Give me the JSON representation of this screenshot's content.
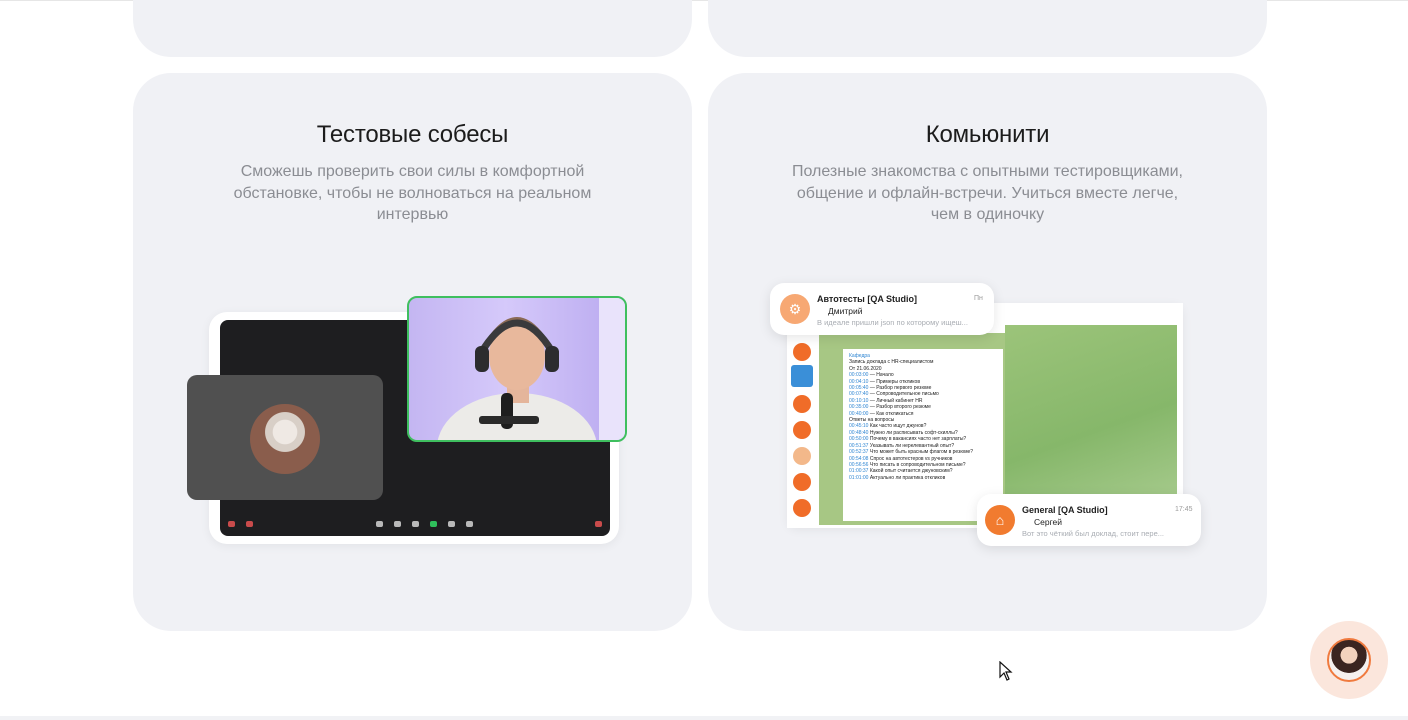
{
  "cards": {
    "interviews": {
      "title": "Тестовые собесы",
      "description_lines": [
        "Сможешь проверить свои силы в комфортной",
        "обстановке, чтобы не волноваться на реальном",
        "интервью"
      ]
    },
    "community": {
      "title": "Комьюнити",
      "description_lines": [
        "Полезные знакомства с опытными тестировщиками,",
        "общение и офлайн-встречи. Учиться вместе легче,",
        "чем в одиночку"
      ]
    }
  },
  "chat_previews": {
    "top": {
      "title": "Автотесты [QA Studio]",
      "time": "Пн",
      "sender": "Дмитрий",
      "message": "В идеале пришли json по которому ищеш..."
    },
    "bottom": {
      "title": "General [QA Studio]",
      "time": "17:45",
      "sender": "Сергей",
      "message": "Вот это чёткий был доклад, стоит пере..."
    }
  },
  "colors": {
    "card_bg": "#f0f1f5",
    "accent_orange": "#f07a3e",
    "tile_border_green": "#3fbf5f",
    "muted_text": "#8b8d93"
  },
  "icons": [
    "robot-icon",
    "home-icon",
    "chat-widget-avatar-icon",
    "mouse-cursor-icon"
  ]
}
